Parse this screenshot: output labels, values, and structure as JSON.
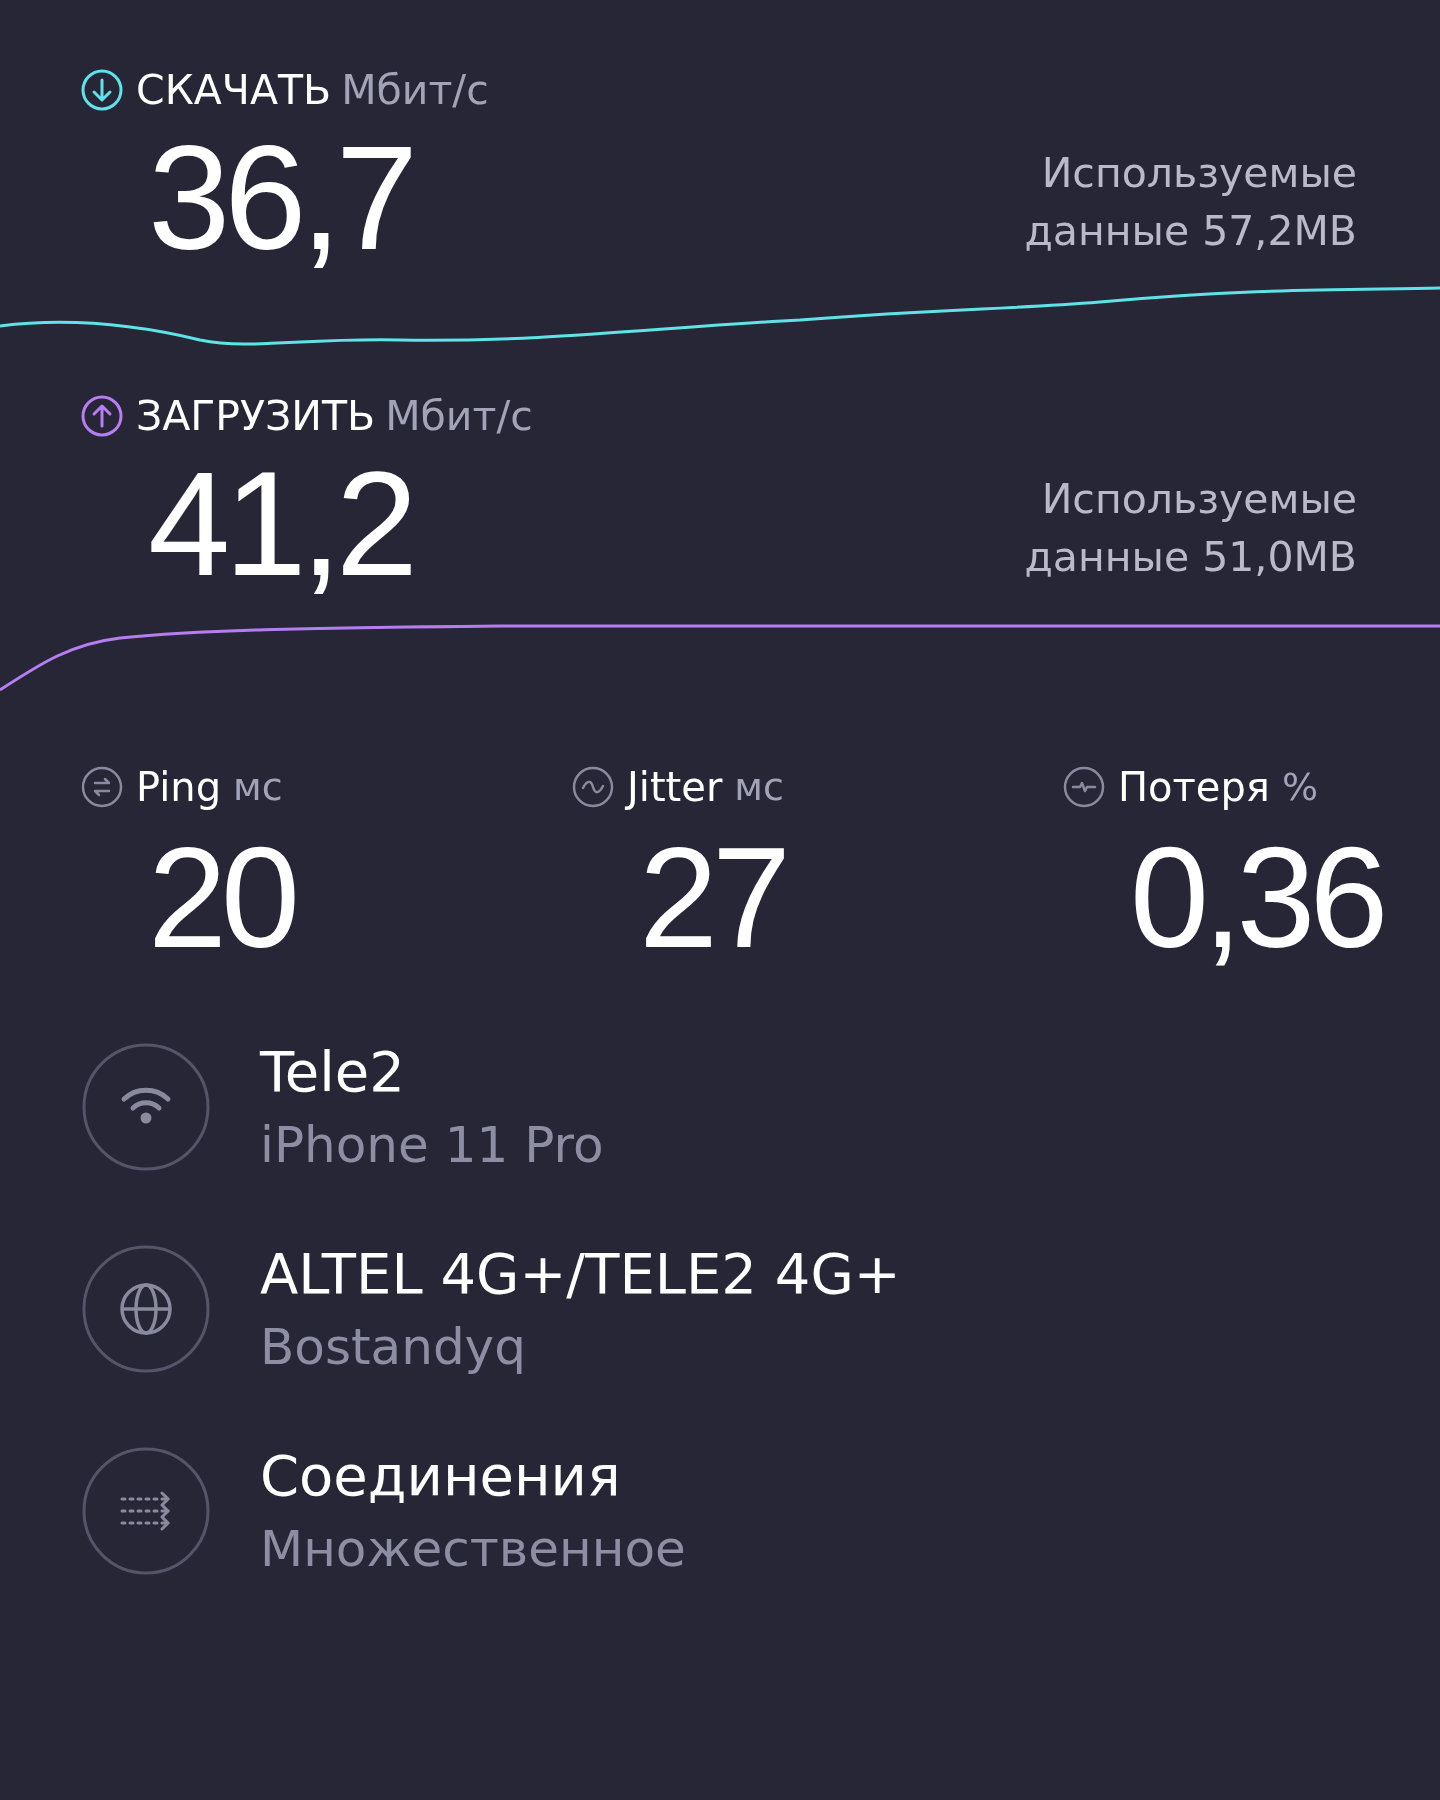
{
  "tests": [
    {
      "kind": "download",
      "label": "СКАЧАТЬ",
      "unit": "Мбит/с",
      "value": "36,7",
      "data_used": "Используемые\nданные 57,2MB",
      "color": "#5fe3e8"
    },
    {
      "kind": "upload",
      "label": "ЗАГРУЗИТЬ",
      "unit": "Мбит/с",
      "value": "41,2",
      "data_used": "Используемые\nданные 51,0MB",
      "color": "#b77ef2"
    }
  ],
  "metrics": [
    {
      "kind": "ping",
      "label": "Ping",
      "unit": "мс",
      "value": "20"
    },
    {
      "kind": "jitter",
      "label": "Jitter",
      "unit": "мс",
      "value": "27"
    },
    {
      "kind": "loss",
      "label": "Потеря",
      "unit": "%",
      "value": "0,36"
    }
  ],
  "info": [
    {
      "kind": "wifi",
      "title": "Tele2",
      "subtitle": "iPhone 11 Pro"
    },
    {
      "kind": "globe",
      "title": "ALTEL 4G+/TELE2 4G+",
      "subtitle": "Bostandyq"
    },
    {
      "kind": "connections",
      "title": "Соединения",
      "subtitle": "Множественное"
    }
  ]
}
